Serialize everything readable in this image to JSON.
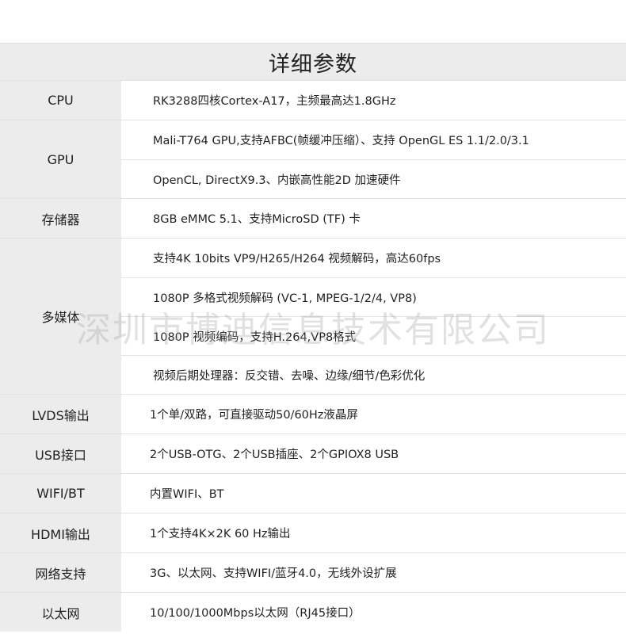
{
  "title": "详细参数",
  "watermark": "深圳市博迪信息技术有限公司",
  "rows": [
    {
      "label": "CPU",
      "values": [
        "RK3288四核Cortex-A17，主频最高达1.8GHz"
      ]
    },
    {
      "label": "GPU",
      "values": [
        "Mali-T764 GPU,支持AFBC(帧缓冲压缩）、支持 OpenGL ES 1.1/2.0/3.1",
        "OpenCL, DirectX9.3、内嵌高性能2D 加速硬件"
      ]
    },
    {
      "label": "存储器",
      "values": [
        "8GB eMMC 5.1、支持MicroSD (TF) 卡"
      ]
    },
    {
      "label": "多媒体",
      "values": [
        "支持4K 10bits VP9/H265/H264 视频解码，高达60fps",
        "1080P 多格式视频解码 (VC-1, MPEG-1/2/4, VP8)",
        "1080P 视频编码，支持H.264,VP8格式",
        "视频后期处理器：反交错、去噪、边缘/细节/色彩优化"
      ]
    },
    {
      "label": "LVDS输出",
      "values": [
        "1个单/双路，可直接驱动50/60Hz液晶屏"
      ]
    },
    {
      "label": "USB接口",
      "values": [
        "2个USB-OTG、2个USB插座、2个GPIOX8 USB"
      ]
    },
    {
      "label": "WIFI/BT",
      "values": [
        "内置WIFI、BT"
      ]
    },
    {
      "label": "HDMI输出",
      "values": [
        "1个支持4K×2K 60 Hz输出"
      ]
    },
    {
      "label": "网络支持",
      "values": [
        "3G、以太网、支持WIFI/蓝牙4.0，无线外设扩展"
      ]
    },
    {
      "label": "以太网",
      "values": [
        "10/100/1000Mbps以太网（RJ45接口）"
      ]
    }
  ]
}
